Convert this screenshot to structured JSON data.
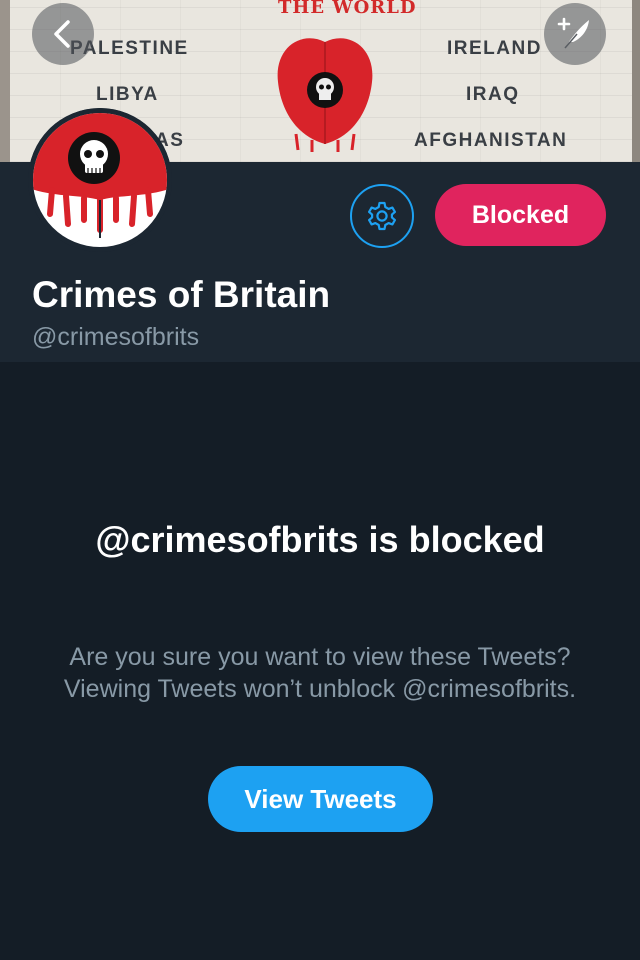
{
  "banner": {
    "title": "THE WORLD",
    "left_words": [
      "PALESTINE",
      "LIBYA",
      "AS"
    ],
    "right_words": [
      "IRELAND",
      "IRAQ",
      "AFGHANISTAN"
    ]
  },
  "nav": {
    "back_icon": "chevron-left-icon",
    "compose_icon": "compose-tweet-icon"
  },
  "profile": {
    "display_name": "Crimes of Britain",
    "handle": "@crimesofbrits",
    "settings_icon": "gear-icon",
    "blocked_label": "Blocked"
  },
  "blocked_notice": {
    "title": "@crimesofbrits is blocked",
    "description": "Are you sure you want to view these Tweets? Viewing Tweets won’t unblock @crimesofbrits.",
    "button_label": "View Tweets"
  },
  "colors": {
    "background": "#141d26",
    "header_background": "#1c2732",
    "accent_blue": "#1da1f2",
    "blocked_red": "#e0245e",
    "muted_text": "#8899a6"
  }
}
